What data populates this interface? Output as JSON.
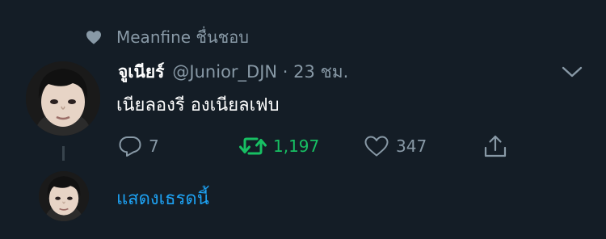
{
  "social_context": {
    "text": "Meanfine ชื่นชอบ"
  },
  "tweet": {
    "display_name": "จูเนียร์",
    "meta": "@Junior_DJN · 23 ชม.",
    "text": "เนียลองรี องเนียลเฟบ",
    "stats": {
      "replies": "7",
      "retweets": "1,197",
      "likes": "347"
    }
  },
  "show_thread": {
    "label": "แสดงเธรดนี้"
  },
  "colors": {
    "background": "#141d26",
    "muted": "#8899a6",
    "retweet": "#17bf63",
    "link": "#1da1f2"
  },
  "icons": [
    "heart-icon",
    "chevron-down-icon",
    "reply-icon",
    "retweet-icon",
    "like-icon",
    "share-icon"
  ]
}
